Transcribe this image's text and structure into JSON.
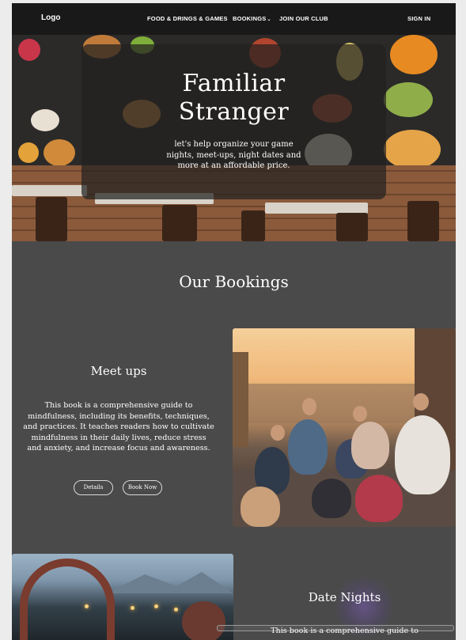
{
  "nav": {
    "logo": "Logo",
    "links": [
      "FOOD & DRINGS & GAMES",
      "BOOKINGS",
      "JOIN OUR CLUB"
    ],
    "bookings_caret": "⌄",
    "sign_in": "SIGN IN"
  },
  "hero": {
    "title_line1": "Familiar",
    "title_line2": "Stranger",
    "text": "let's help organize your game nights, meet-ups, night dates and more at an affordable price."
  },
  "bookings": {
    "heading": "Our Bookings",
    "cards": [
      {
        "title": "Meet ups",
        "text": "This book is a comprehensive guide to mindfulness, including its benefits, techniques, and practices. It teaches readers how to cultivate mindfulness in their daily lives, reduce stress and anxiety, and increase focus and awareness.",
        "details_label": "Details",
        "book_label": "Book Now"
      },
      {
        "title": "Date Nights",
        "text": "This book is a comprehensive guide to"
      }
    ]
  },
  "colors": {
    "page_bg": "#4a4a4a",
    "nav_bg": "#141414",
    "outer_bg": "#ececec"
  }
}
